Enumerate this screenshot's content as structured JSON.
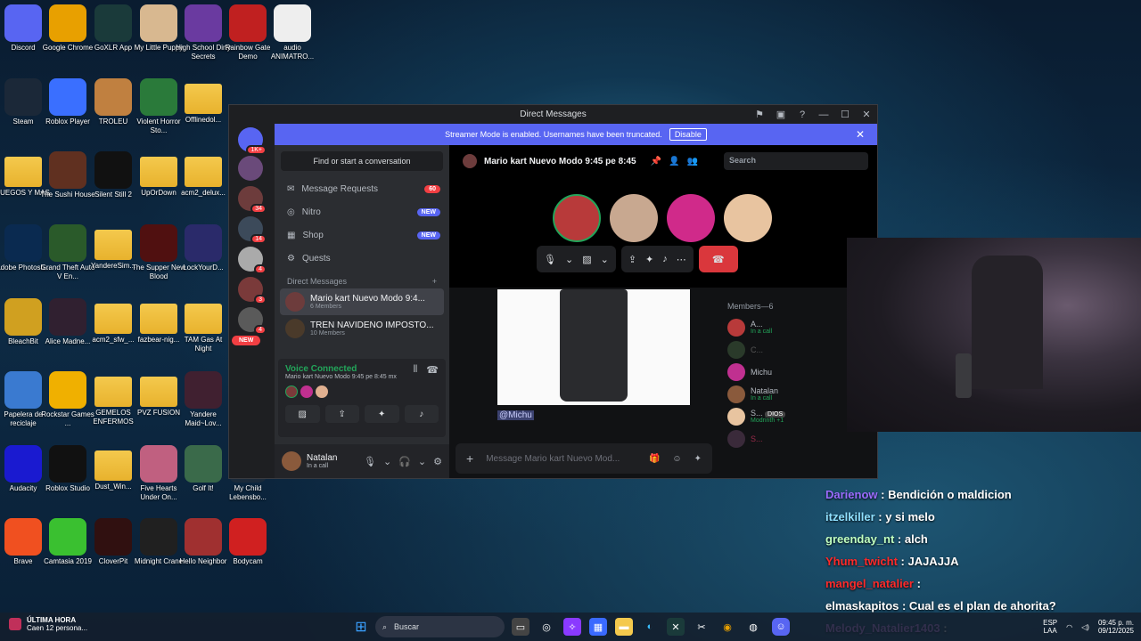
{
  "desktop": {
    "icons": [
      {
        "label": "Discord",
        "icon": "discord-icon",
        "color": "#5865f2"
      },
      {
        "label": "Google Chrome",
        "icon": "chrome-icon",
        "color": "#e8a000"
      },
      {
        "label": "GoXLR App",
        "icon": "goxlr-icon",
        "color": "#1a3a3a"
      },
      {
        "label": "My Little Puppy",
        "icon": "puppy-icon",
        "color": "#d8b890"
      },
      {
        "label": "High School Dirty Secrets",
        "icon": "game-icon",
        "color": "#6a3aa0"
      },
      {
        "label": "Rainbow Gate Demo",
        "icon": "bear-icon",
        "color": "#c02020"
      },
      {
        "label": "audio ANIMATRO...",
        "icon": "audio-icon",
        "color": "#eeeeee"
      },
      {
        "label": "Steam",
        "icon": "steam-icon",
        "color": "#1b2838"
      },
      {
        "label": "Roblox Player",
        "icon": "roblox-icon",
        "color": "#3a6fff"
      },
      {
        "label": "TROLEU",
        "icon": "troll-icon",
        "color": "#c08040"
      },
      {
        "label": "Violent Horror Sto...",
        "icon": "game-icon",
        "color": "#2a7a3a"
      },
      {
        "label": "Offlinedol...",
        "icon": "folder-icon",
        "color": "#f4c94d"
      },
      {
        "label": "JUEGOS Y MAS",
        "icon": "folder-icon",
        "color": "#f4c94d"
      },
      {
        "label": "The Sushi House",
        "icon": "game-icon",
        "color": "#603020"
      },
      {
        "label": "Silent Still 2",
        "icon": "game-icon",
        "color": "#111111"
      },
      {
        "label": "UpOrDown",
        "icon": "folder-icon",
        "color": "#f4c94d"
      },
      {
        "label": "acm2_delux...",
        "icon": "folder-icon",
        "color": "#f4c94d"
      },
      {
        "label": "Adobe Photosh...",
        "icon": "photoshop-icon",
        "color": "#0a2a50"
      },
      {
        "label": "Grand Theft Auto V En...",
        "icon": "gta-icon",
        "color": "#2a5a2a"
      },
      {
        "label": "YandereSim...",
        "icon": "folder-icon",
        "color": "#f4c94d"
      },
      {
        "label": "The Supper New Blood",
        "icon": "game-icon",
        "color": "#501010"
      },
      {
        "label": "LockYourD...",
        "icon": "game-icon",
        "color": "#2a2a6a"
      },
      {
        "label": "BleachBit",
        "icon": "broom-icon",
        "color": "#d0a020"
      },
      {
        "label": "Alice Madne...",
        "icon": "game-icon",
        "color": "#302030"
      },
      {
        "label": "acm2_sfw_...",
        "icon": "folder-icon",
        "color": "#f4c94d"
      },
      {
        "label": "fazbear-nig...",
        "icon": "folder-icon",
        "color": "#f4c94d"
      },
      {
        "label": "TAM Gas At Night",
        "icon": "folder-icon",
        "color": "#f4c94d"
      },
      {
        "label": "Papelera de reciclaje",
        "icon": "recycle-bin-icon",
        "color": "#3a7ad0"
      },
      {
        "label": "Rockstar Games ...",
        "icon": "rockstar-icon",
        "color": "#f0b000"
      },
      {
        "label": "GEMELOS ENFERMOS",
        "icon": "folder-icon",
        "color": "#f4c94d"
      },
      {
        "label": "PVZ FUSION",
        "icon": "folder-icon",
        "color": "#f4c94d"
      },
      {
        "label": "Yandere Maid~Lov...",
        "icon": "game-icon",
        "color": "#402030"
      },
      {
        "label": "Audacity",
        "icon": "audacity-icon",
        "color": "#1a1ad0"
      },
      {
        "label": "Roblox Studio",
        "icon": "roblox-studio-icon",
        "color": "#111111"
      },
      {
        "label": "Dust_Win...",
        "icon": "folder-icon",
        "color": "#f4c94d"
      },
      {
        "label": "Five Hearts Under On...",
        "icon": "game-icon",
        "color": "#c06080"
      },
      {
        "label": "Golf It!",
        "icon": "golf-icon",
        "color": "#3a6a4a"
      },
      {
        "label": "My Child Lebensbo...",
        "icon": "game-icon",
        "color": "#1a2a3a"
      },
      {
        "label": "Brave",
        "icon": "brave-icon",
        "color": "#f05020"
      },
      {
        "label": "Camtasia 2019",
        "icon": "camtasia-icon",
        "color": "#3ac030"
      },
      {
        "label": "CloverPit",
        "icon": "game-icon",
        "color": "#301010"
      },
      {
        "label": "Midnight Crane",
        "icon": "game-icon",
        "color": "#202020"
      },
      {
        "label": "Hello Neighbor",
        "icon": "game-icon",
        "color": "#a03030"
      },
      {
        "label": "Bodycam",
        "icon": "game-icon",
        "color": "#d02020"
      }
    ]
  },
  "discord": {
    "window_title": "Direct Messages",
    "streamer_banner": "Streamer Mode is enabled. Usernames have been truncated.",
    "streamer_disable": "Disable",
    "guild_badges": [
      "1K+",
      "34",
      "14",
      "4",
      "3",
      "4"
    ],
    "guild_new": "NEW",
    "find_placeholder": "Find or start a conversation",
    "nav": {
      "requests": "Message Requests",
      "requests_count": "60",
      "nitro": "Nitro",
      "nitro_badge": "NEW",
      "shop": "Shop",
      "shop_badge": "NEW",
      "quests": "Quests"
    },
    "dm_header": "Direct Messages",
    "dms": [
      {
        "name": "Mario kart Nuevo Modo 9:4...",
        "sub": "6 Members"
      },
      {
        "name": "TREN NAVIDEÑO IMPOSTO...",
        "sub": "10 Members"
      }
    ],
    "voice": {
      "status": "Voice Connected",
      "channel": "Mario kart Nuevo Modo 9:45 pe 8:45 mx"
    },
    "user": {
      "name": "Natalan",
      "status": "In a call"
    },
    "channel_title": "Mario kart Nuevo Modo 9:45 pe 8:45",
    "search_placeholder": "Search",
    "mention": "@Michu",
    "message_placeholder": "Message Mario kart Nuevo Mod...",
    "members_header": "Members—6",
    "members": [
      {
        "name": "A...",
        "status": "In a call"
      },
      {
        "name": "C...",
        "status": ""
      },
      {
        "name": "Michu",
        "status": ""
      },
      {
        "name": "Natalan",
        "status": "In a call"
      },
      {
        "name": "S...",
        "status": "Modrinth +1",
        "tag": "DIOS"
      },
      {
        "name": "S...",
        "status": ""
      }
    ],
    "colors": {
      "blurple": "#5865f2",
      "green": "#23a55a",
      "red": "#da373c"
    }
  },
  "overlay_chat": [
    {
      "user": "Darienow",
      "text": ": Bendición o maldicion",
      "color": "#9b6cff"
    },
    {
      "user": "itzelkiller",
      "text": ": y si melo",
      "color": "#8fe0ff"
    },
    {
      "user": "greenday_nt",
      "text": ": alch",
      "color": "#c0ffc0"
    },
    {
      "user": "Yhum_twicht",
      "text": ": JAJAJJA",
      "color": "#ff2a2a"
    },
    {
      "user": "mangel_natalier",
      "text": ":",
      "color": "#ff2a2a"
    },
    {
      "user": "elmaskapitos",
      "text": ": Cual es el plan de ahorita?",
      "color": "#ffffff"
    },
    {
      "user": "Melody_Natalier1403",
      "text": ":",
      "color": "#d88fff"
    }
  ],
  "taskbar": {
    "news_title": "ÚLTIMA HORA",
    "news_sub": "Caen 12 persona...",
    "search": "Buscar",
    "lang1": "ESP",
    "lang2": "LAA",
    "time": "09:45 p. m.",
    "date": "09/12/2025"
  }
}
